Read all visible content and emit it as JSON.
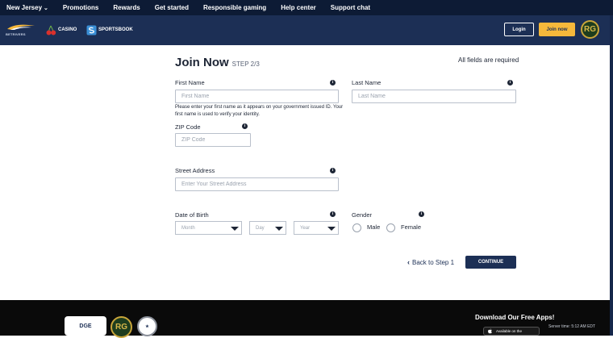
{
  "topnav": {
    "state": "New Jersey",
    "items": [
      "Promotions",
      "Rewards",
      "Get started",
      "Responsible gaming",
      "Help center",
      "Support chat"
    ]
  },
  "header": {
    "logo_text": "BETRIVERS",
    "casino": "CASINO",
    "sportsbook": "SPORTSBOOK",
    "login": "Login",
    "join": "Join now",
    "rg": "RG"
  },
  "form": {
    "title": "Join Now",
    "step": "STEP 2/3",
    "required_note": "All fields are required",
    "first_name": {
      "label": "First Name",
      "placeholder": "First Name"
    },
    "last_name": {
      "label": "Last Name",
      "placeholder": "Last Name"
    },
    "help_text": "Please enter your first name as it appears on your government issued ID. Your first name is used to verify your identity.",
    "zip": {
      "label": "ZIP Code",
      "placeholder": "ZIP Code"
    },
    "street": {
      "label": "Street Address",
      "placeholder": "Enter Your Street Address"
    },
    "dob": {
      "label": "Date of Birth",
      "month": "Month",
      "day": "Day",
      "year": "Year"
    },
    "gender": {
      "label": "Gender",
      "male": "Male",
      "female": "Female"
    },
    "back": "Back to Step 1",
    "continue": "CONTINUE"
  },
  "footer": {
    "dge": "DGE",
    "rg": "RG",
    "download": "Download Our Free Apps!",
    "server_time": "Server time: 5:12 AM EDT",
    "appstore": "Available on the"
  },
  "colors": {
    "nav_bg": "#0d1b35",
    "header_bg": "#1c2f55",
    "accent": "#f5b83b",
    "button": "#1c2f55"
  }
}
